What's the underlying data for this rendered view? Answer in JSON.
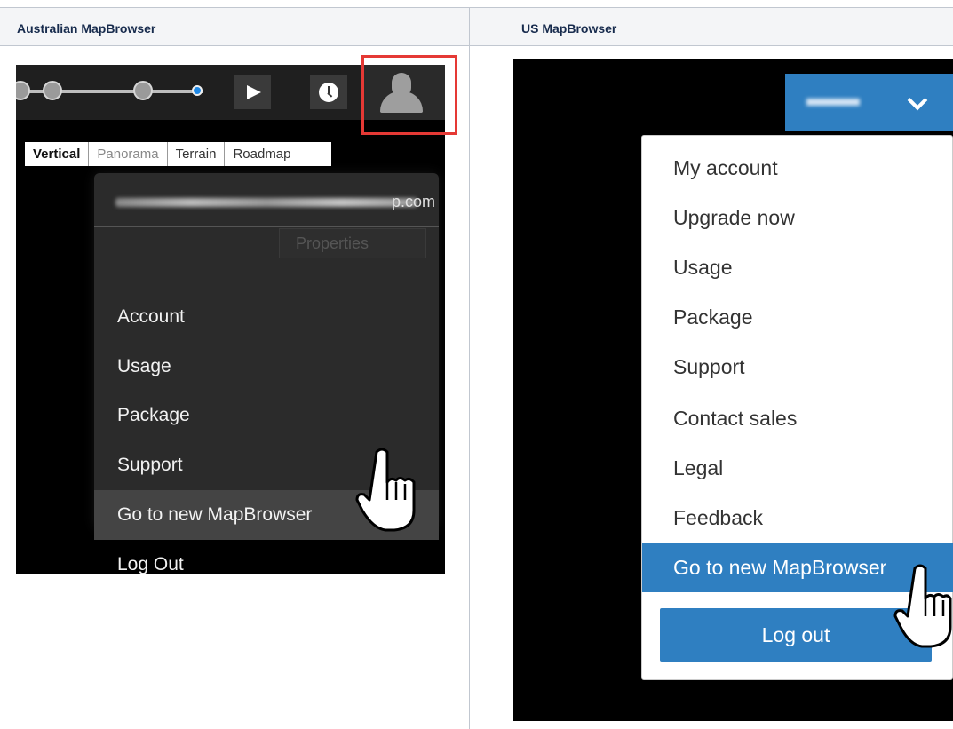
{
  "headers": {
    "au": "Australian MapBrowser",
    "us": "US MapBrowser"
  },
  "au": {
    "tabs": [
      "Vertical",
      "Panorama",
      "Terrain",
      "Roadmap"
    ],
    "email_visible": "p.com",
    "properties_label": "Properties",
    "menu": [
      "Account",
      "Usage",
      "Package",
      "Support",
      "Go to new MapBrowser",
      "Log Out"
    ],
    "highlighted": "Go to new MapBrowser"
  },
  "us": {
    "menu": [
      "My account",
      "Upgrade now",
      "Usage",
      "Package",
      "Support",
      "Contact sales",
      "Legal",
      "Feedback",
      "Go to new MapBrowser"
    ],
    "logout": "Log out",
    "highlighted": "Go to new MapBrowser"
  },
  "colors": {
    "accent_blue": "#2f7fc1",
    "highlight_red": "#e53935",
    "header_bg": "#f4f5f7"
  },
  "icons": [
    "user-icon",
    "play-icon",
    "clock-icon",
    "chevron-down-icon",
    "hand-cursor-icon"
  ]
}
